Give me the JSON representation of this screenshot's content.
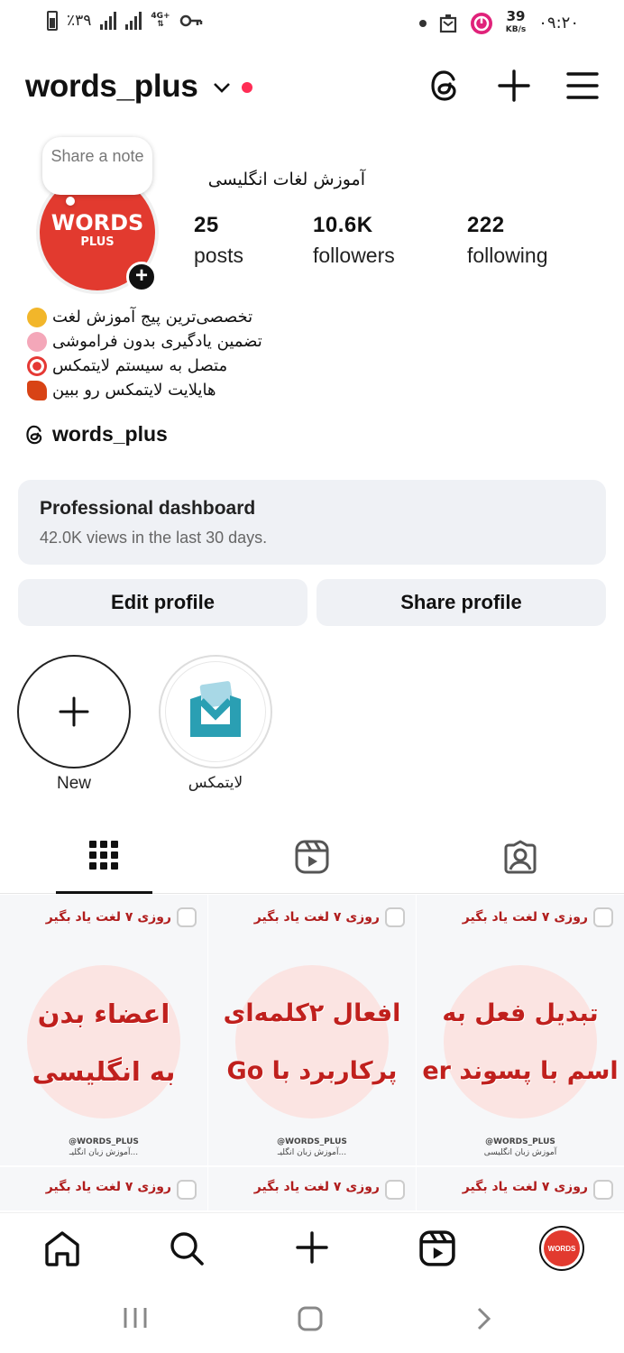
{
  "status_bar": {
    "battery_text": "٪۳۹",
    "network": "4G+",
    "speed_value": "39",
    "speed_unit": "KB/s",
    "time": "۰۹:۲۰"
  },
  "header": {
    "username": "words_plus"
  },
  "profile": {
    "note_text": "Share a note",
    "avatar_text_main": "WORDS",
    "avatar_text_sub": "PLUS",
    "display_name": "آموزش لغات انگلیسی",
    "stats": [
      {
        "value": "25",
        "label": "posts"
      },
      {
        "value": "10.6K",
        "label": "followers"
      },
      {
        "value": "222",
        "label": "following"
      }
    ],
    "bio": [
      {
        "text": "تخصصی‌ترین پیج آموزش لغت",
        "emoji": "flexed-biceps",
        "color": "#f2b62a"
      },
      {
        "text": "تضمین یادگیری بدون فراموشی",
        "emoji": "brain",
        "color": "#f4a7b9"
      },
      {
        "text": "متصل به سیستم لایتمکس",
        "emoji": "direct-hit",
        "color": "#e53935"
      },
      {
        "text": "هایلایت لایتمکس رو ببین",
        "emoji": "rocket",
        "color": "#d84315"
      }
    ],
    "threads_handle": "words_plus"
  },
  "dashboard": {
    "title": "Professional dashboard",
    "subtitle": "42.0K views in the last 30 days."
  },
  "buttons": {
    "edit": "Edit profile",
    "share": "Share profile"
  },
  "highlights": [
    {
      "label": "New"
    },
    {
      "label": "لایتمکس"
    }
  ],
  "posts": [
    {
      "top": "روزی ۷ لغت یاد بگیر",
      "line1": "تبدیل فعل به",
      "line2": "اسم با پسوند er",
      "handle": "@WORDS_PLUS",
      "tagline": "آموزش زبان انگلیسی"
    },
    {
      "top": "روزی ۷ لغت یاد بگیر",
      "line1": "افعال ۲کلمه‌ای",
      "line2": "پرکاربرد با Go",
      "handle": "@WORDS_PLUS",
      "tagline": "آموزش زبان انگلیـ..."
    },
    {
      "top": "روزی ۷ لغت یاد بگیر",
      "line1": "اعضاء بدن",
      "line2": "به انگلیسی",
      "handle": "@WORDS_PLUS",
      "tagline": "آموزش زبان انگلیـ..."
    }
  ],
  "posts_row2": [
    {
      "top": "روزی ۷ لغت یاد بگیر"
    },
    {
      "top": "روزی ۷ لغت یاد بگیر"
    },
    {
      "top": "روزی ۷ لغت یاد بگیر"
    }
  ],
  "colors": {
    "accent_red": "#e23a2f",
    "notification_dot": "#ff2d55",
    "highlight_teal": "#2a9fb3",
    "button_bg": "#eff1f5"
  }
}
